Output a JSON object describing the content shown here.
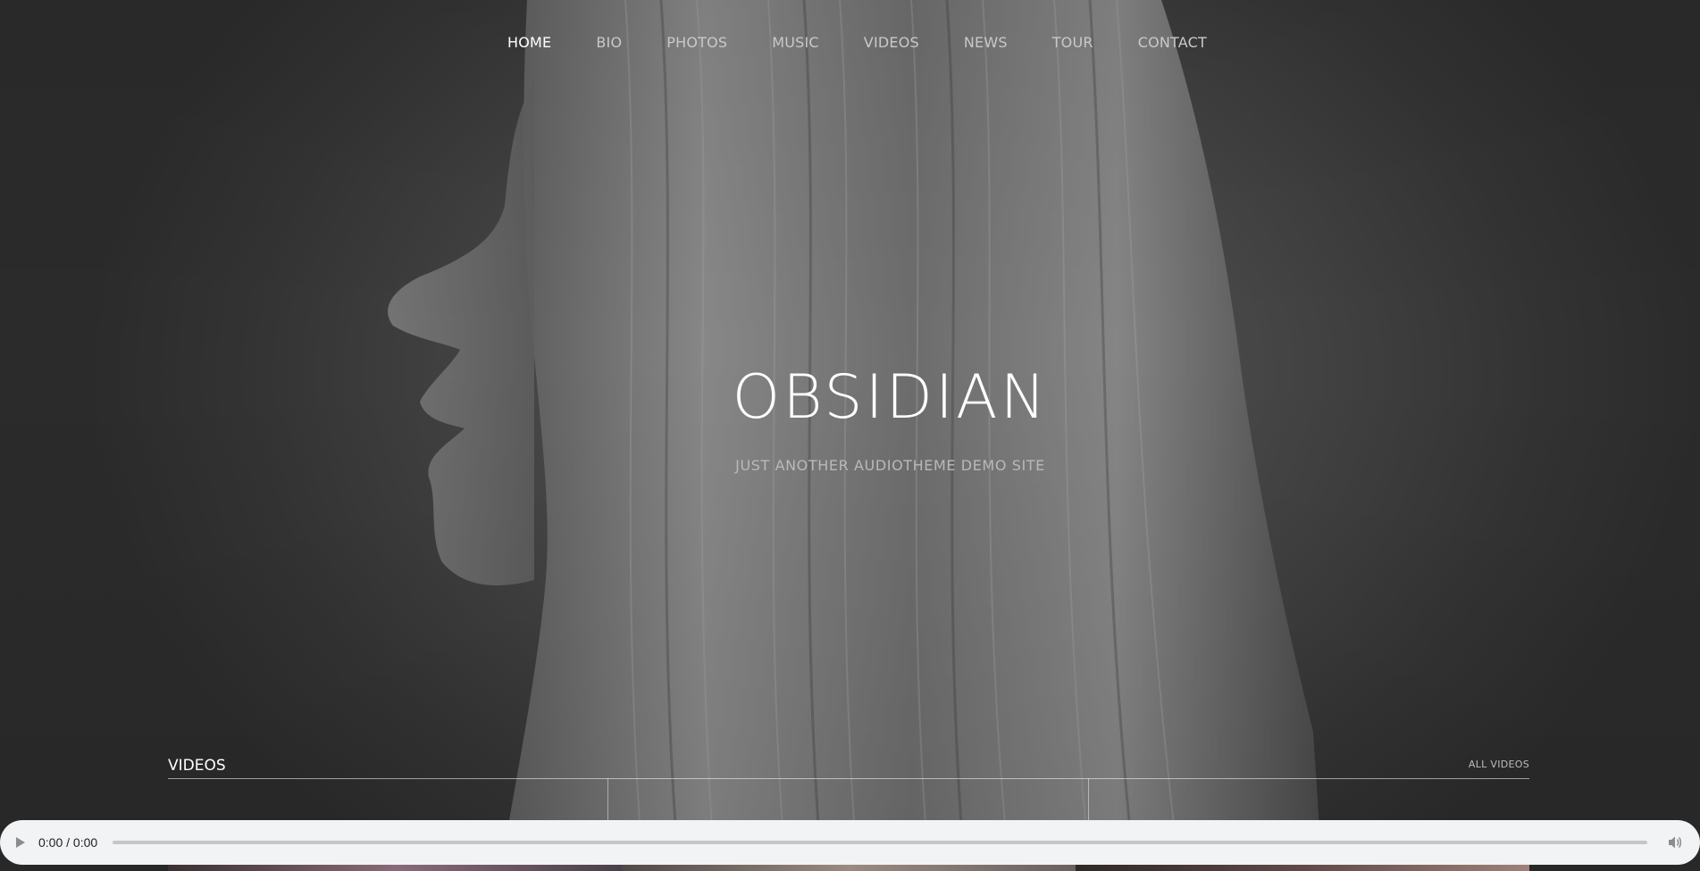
{
  "nav": {
    "items": [
      {
        "label": "HOME",
        "active": true
      },
      {
        "label": "BIO"
      },
      {
        "label": "PHOTOS"
      },
      {
        "label": "MUSIC"
      },
      {
        "label": "VIDEOS"
      },
      {
        "label": "NEWS"
      },
      {
        "label": "TOUR"
      },
      {
        "label": "CONTACT"
      }
    ]
  },
  "hero": {
    "title": "OBSIDIAN",
    "tagline": "JUST ANOTHER AUDIOTHEME DEMO SITE"
  },
  "videos": {
    "title": "VIDEOS",
    "all_link": "ALL VIDEOS"
  },
  "player": {
    "time": "0:00 / 0:00",
    "play_icon": "play-icon",
    "volume_icon": "volume-icon",
    "progress": 0
  },
  "colors": {
    "player_bg": "#f1f3f4",
    "text_active": "#ffffff",
    "text_muted": "#c9c9c9"
  }
}
